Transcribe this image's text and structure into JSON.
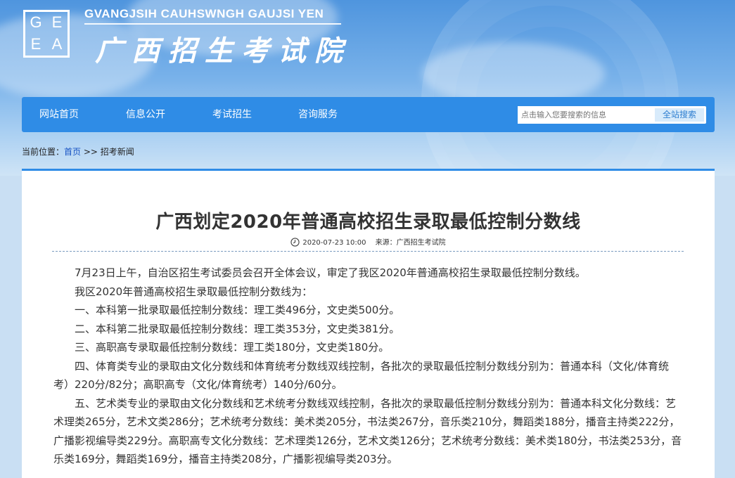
{
  "header": {
    "logo_letters": [
      "G",
      "E",
      "E",
      "A"
    ],
    "site_name_en": "GVANGJSIH CAUHSWNGH GAUJSI YEN",
    "site_name_cn": "广西招生考试院"
  },
  "nav": {
    "items": [
      "网站首页",
      "信息公开",
      "考试招生",
      "咨询服务"
    ],
    "search_placeholder": "点击输入您要搜索的信息",
    "search_button": "全站搜索"
  },
  "breadcrumb": {
    "prefix": "当前位置：",
    "home": "首页",
    "sep": ">>",
    "current": "招考新闻"
  },
  "article": {
    "title": "广西划定2020年普通高校招生录取最低控制分数线",
    "date": "2020-07-23 10:00",
    "source": "来源：广西招生考试院",
    "paragraphs": [
      "7月23日上午，自治区招生考试委员会召开全体会议，审定了我区2020年普通高校招生录取最低控制分数线。",
      "我区2020年普通高校招生录取最低控制分数线为：",
      "一、本科第一批录取最低控制分数线：理工类496分，文史类500分。",
      "二、本科第二批录取最低控制分数线：理工类353分，文史类381分。",
      "三、高职高专录取最低控制分数线：理工类180分，文史类180分。",
      "四、体育类专业的录取由文化分数线和体育统考分数线双线控制，各批次的录取最低控制分数线分别为：普通本科（文化/体育统考）220分/82分；高职高专（文化/体育统考）140分/60分。",
      "五、艺术类专业的录取由文化分数线和艺术统考分数线双线控制，各批次的录取最低控制分数线分别为：普通本科文化分数线：艺术理类265分，艺术文类286分；艺术统考分数线：美术类205分，书法类267分，音乐类210分，舞蹈类188分，播音主持类222分，广播影视编导类229分。高职高专文化分数线：艺术理类126分，艺术文类126分；艺术统考分数线：美术类180分，书法类253分，音乐类169分，舞蹈类169分，播音主持类208分，广播影视编导类203分。"
    ]
  },
  "colors": {
    "nav_bg": "#2f8ce6",
    "link": "#1a55c4"
  }
}
